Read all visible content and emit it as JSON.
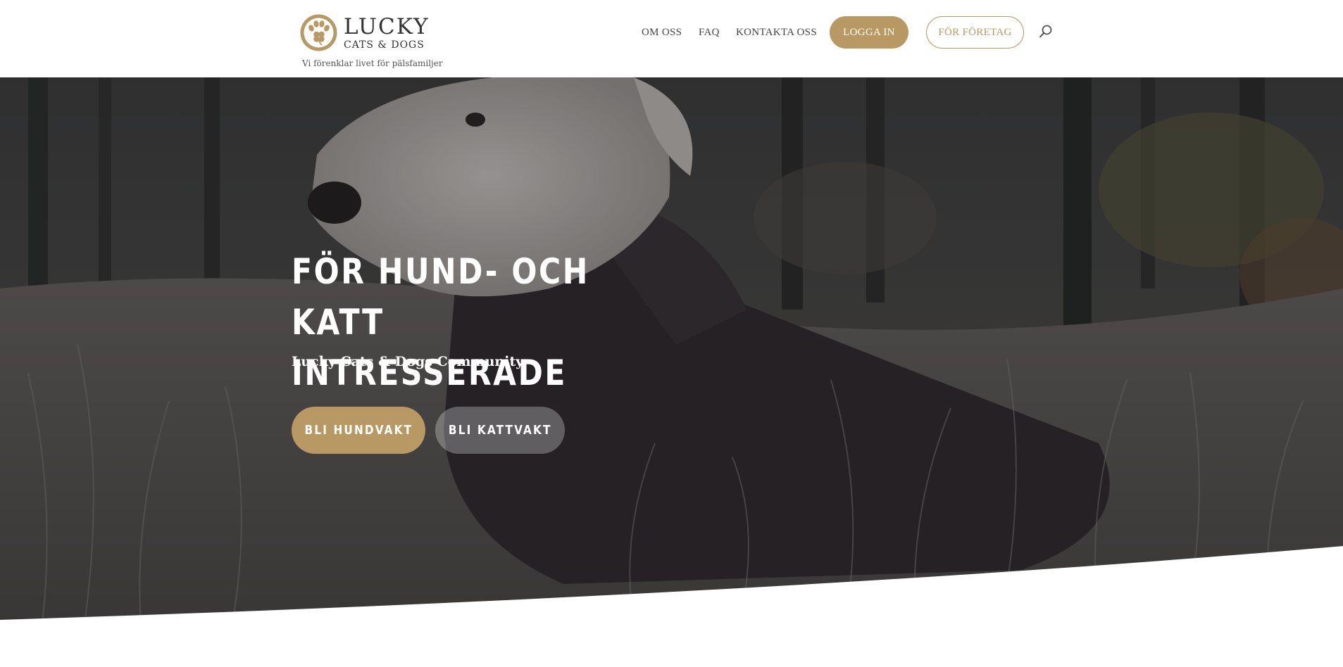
{
  "brand": {
    "name": "LUCKY",
    "sub": "CATS & DOGS",
    "tagline": "Vi förenklar livet för pälsfamiljer",
    "logo_icon": "paw-clover-icon",
    "accent_color": "#b89963"
  },
  "nav": {
    "items": [
      {
        "label": "OM OSS"
      },
      {
        "label": "FAQ"
      },
      {
        "label": "KONTAKTA OSS"
      }
    ],
    "login_label": "LOGGA IN",
    "business_label": "FÖR FÖRETAG",
    "search_icon": "search-icon"
  },
  "hero": {
    "title": "FÖR HUND- OCH KATT INTRESSERADE",
    "subtitle": "Lucky Cats & Dogs Community",
    "primary_button": "BLI HUNDVAKT",
    "secondary_button": "BLI KATTVAKT",
    "background": "photo of a white dog in a dark coat lying in tall grass in a forest"
  }
}
